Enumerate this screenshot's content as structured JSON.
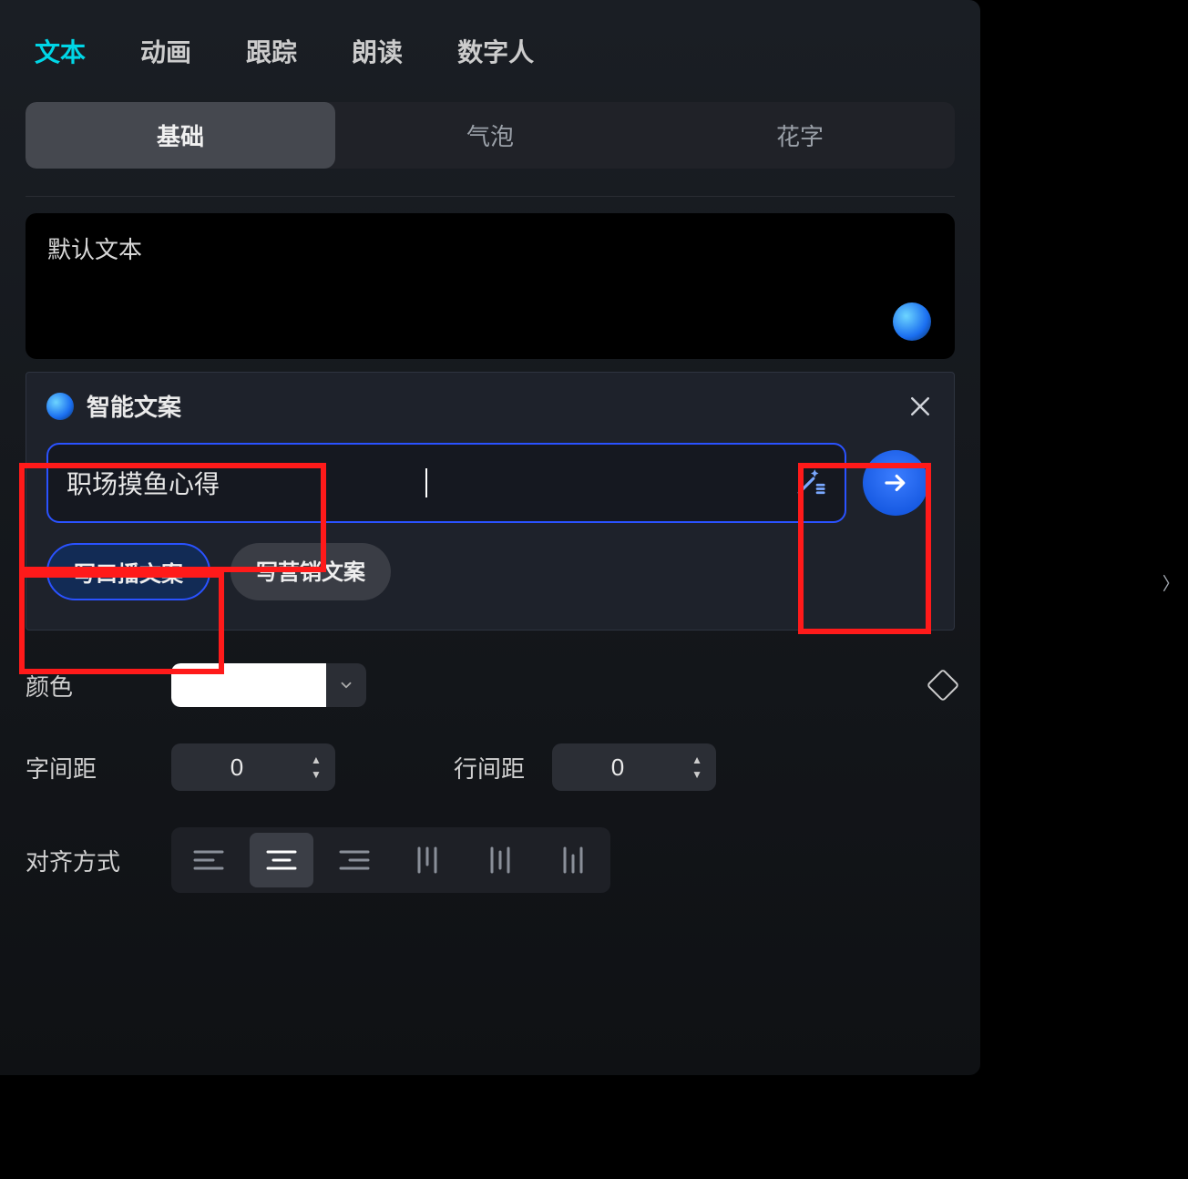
{
  "topTabs": {
    "items": [
      "文本",
      "动画",
      "跟踪",
      "朗读",
      "数字人"
    ],
    "activeIndex": 0
  },
  "subTabs": {
    "items": [
      "基础",
      "气泡",
      "花字"
    ],
    "activeIndex": 0
  },
  "textArea": {
    "value": "默认文本"
  },
  "aiPopup": {
    "title": "智能文案",
    "inputValue": "职场摸鱼心得",
    "chips": [
      "写口播文案",
      "写营销文案"
    ],
    "chipActiveIndex": 0
  },
  "color": {
    "label": "颜色",
    "value": "#FFFFFF"
  },
  "letterSpacing": {
    "label": "字间距",
    "value": "0"
  },
  "lineSpacing": {
    "label": "行间距",
    "value": "0"
  },
  "align": {
    "label": "对齐方式",
    "activeIndex": 1
  }
}
